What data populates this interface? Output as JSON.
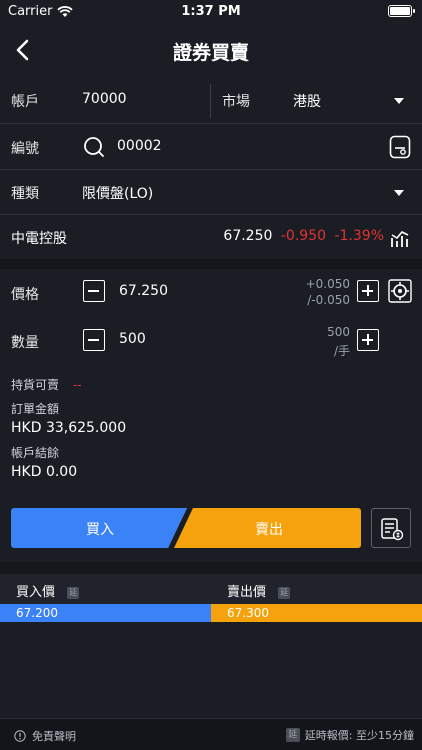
{
  "status": {
    "carrier": "Carrier",
    "time": "1:37 PM"
  },
  "nav": {
    "title": "證券買賣"
  },
  "account": {
    "label": "帳戶",
    "value": "70000"
  },
  "market": {
    "label": "市場",
    "value": "港股"
  },
  "code": {
    "label": "編號",
    "value": "00002"
  },
  "type": {
    "label": "種類",
    "value": "限價盤(LO)"
  },
  "stock": {
    "name": "中電控股",
    "price": "67.250",
    "change": "-0.950",
    "change_pct": "-1.39%",
    "down_color": "#e0352f"
  },
  "price": {
    "label": "價格",
    "value": "67.250",
    "step_up": "+0.050",
    "step_down": "/-0.050"
  },
  "quantity": {
    "label": "數量",
    "value": "500",
    "lot": "500",
    "lot_unit": "/手"
  },
  "holdings": {
    "label": "持貨可賣",
    "value": "--"
  },
  "order_amount": {
    "label": "訂單金額",
    "value": "HKD 33,625.000"
  },
  "balance": {
    "label": "帳戶結餘",
    "value": "HKD 0.00"
  },
  "actions": {
    "buy": "買入",
    "sell": "賣出"
  },
  "bidask": {
    "bid_label": "買入價",
    "ask_label": "賣出價",
    "delay_tag": "延",
    "bid_value": "67.200",
    "ask_value": "67.300",
    "bid_color": "#3b82f6",
    "ask_color": "#f5a20c"
  },
  "footer": {
    "disclaimer": "免責聲明",
    "delay_tag": "延",
    "delay_note": "延時報價: 至少15分鐘"
  }
}
